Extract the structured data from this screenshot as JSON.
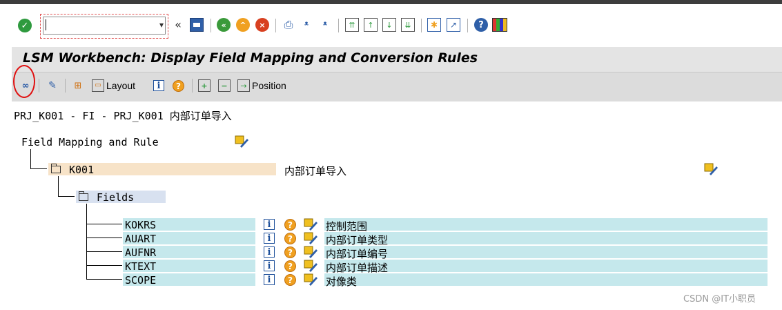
{
  "toolbar": {
    "command_field_value": "",
    "icons": [
      "enter-icon",
      "save-icon",
      "back-icon",
      "exit-icon",
      "cancel-icon",
      "print-icon",
      "find-icon",
      "find-next-icon",
      "first-page-icon",
      "previous-page-icon",
      "next-page-icon",
      "last-page-icon",
      "create-session-icon",
      "shortcut-icon",
      "help-icon",
      "layout-menu-icon"
    ]
  },
  "title": "LSM Workbench: Display Field Mapping and Conversion Rules",
  "app_toolbar": {
    "layout_label": "Layout",
    "position_label": "Position"
  },
  "header_line": "PRJ_K001 - FI - PRJ_K001 内部订单导入",
  "tree": {
    "root_label": "Field Mapping and Rule",
    "object": {
      "name": "K001",
      "description": "内部订单导入"
    },
    "fields_label": "Fields",
    "fields": [
      {
        "name": "KOKRS",
        "description": "控制范围"
      },
      {
        "name": "AUART",
        "description": "内部订单类型"
      },
      {
        "name": "AUFNR",
        "description": "内部订单编号"
      },
      {
        "name": "KTEXT",
        "description": "内部订单描述"
      },
      {
        "name": "SCOPE",
        "description": "对像类"
      }
    ]
  },
  "colors": {
    "object_bg": "#f7e3c8",
    "fields_node_bg": "#d8e1f0",
    "field_row_bg": "#c5e8ec",
    "highlight_circle": "#e01010"
  },
  "watermark": "CSDN @IT小职员"
}
